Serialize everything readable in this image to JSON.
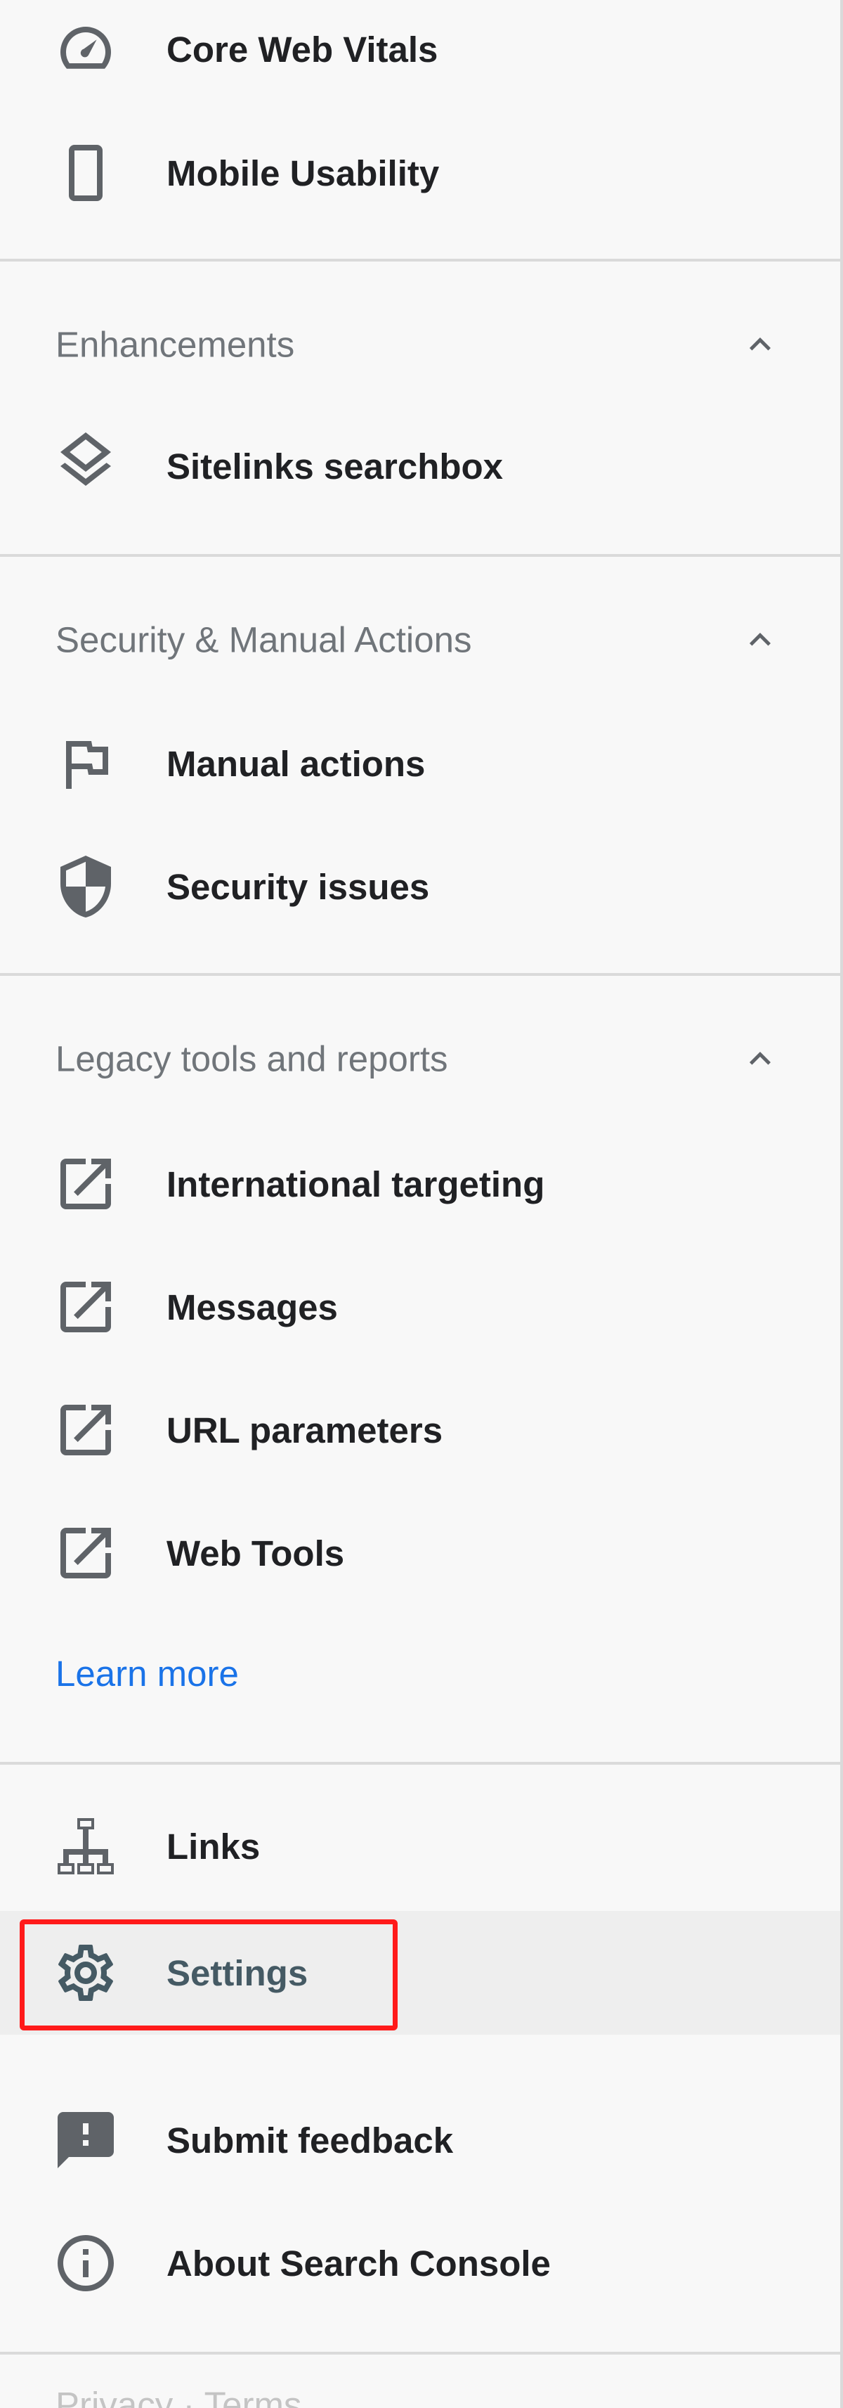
{
  "nav": {
    "top_items": [
      {
        "label": "Core Web Vitals",
        "icon": "speed-gauge-icon"
      },
      {
        "label": "Mobile Usability",
        "icon": "smartphone-icon"
      }
    ],
    "sections": [
      {
        "title": "Enhancements",
        "items": [
          {
            "label": "Sitelinks searchbox",
            "icon": "layers-icon"
          }
        ]
      },
      {
        "title": "Security & Manual Actions",
        "items": [
          {
            "label": "Manual actions",
            "icon": "flag-icon"
          },
          {
            "label": "Security issues",
            "icon": "shield-icon"
          }
        ]
      },
      {
        "title": "Legacy tools and reports",
        "items": [
          {
            "label": "International targeting",
            "icon": "open-in-new-icon"
          },
          {
            "label": "Messages",
            "icon": "open-in-new-icon"
          },
          {
            "label": "URL parameters",
            "icon": "open-in-new-icon"
          },
          {
            "label": "Web Tools",
            "icon": "open-in-new-icon"
          }
        ],
        "learn_more": "Learn more"
      }
    ],
    "bottom_items": [
      {
        "label": "Links",
        "icon": "sitemap-icon"
      },
      {
        "label": "Settings",
        "icon": "gear-icon",
        "active": true
      }
    ],
    "footer_items": [
      {
        "label": "Submit feedback",
        "icon": "feedback-icon"
      },
      {
        "label": "About Search Console",
        "icon": "info-icon"
      }
    ],
    "trailing_text": "Privacy · Terms"
  },
  "colors": {
    "text": "#202124",
    "section_title": "#70757a",
    "icon": "#5f6368",
    "link": "#1a73e8",
    "active_bg": "#eeeeee",
    "active_text": "#455a64",
    "highlight": "#ff1a1a"
  }
}
